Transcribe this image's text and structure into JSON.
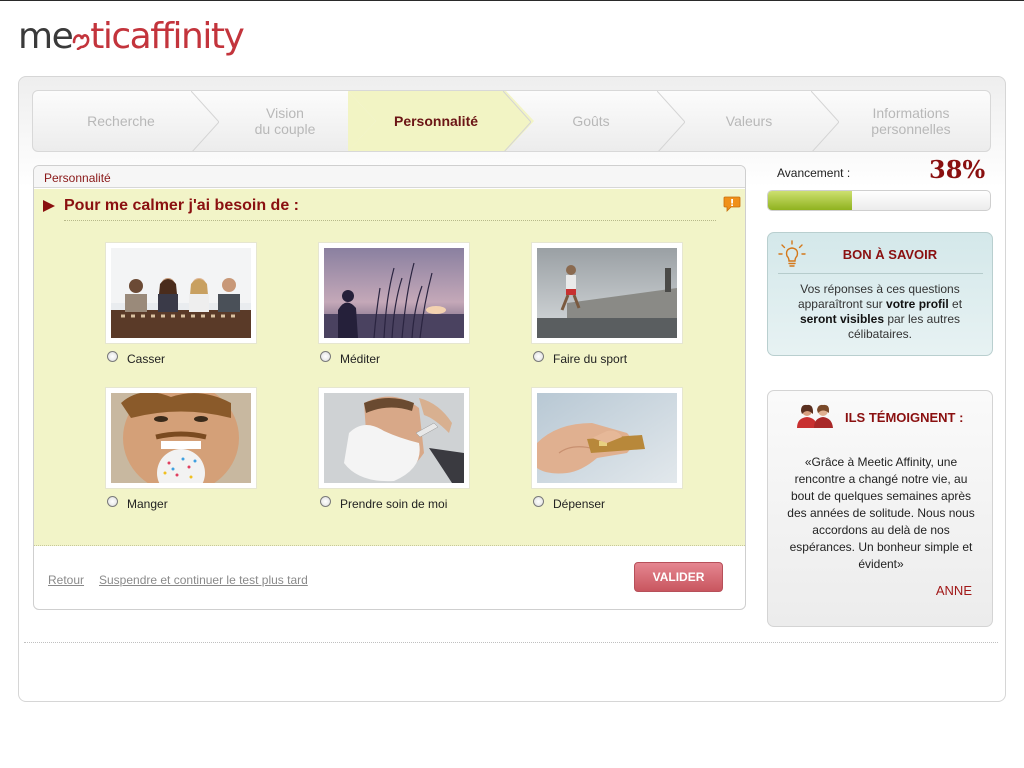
{
  "brand": {
    "logo_part1": "me",
    "logo_part2": "tic",
    "logo_part3": "affinity",
    "colors": {
      "brand_red": "#c3343c",
      "dark_red": "#8a1010",
      "question_bg": "#f2f4c8",
      "progress_green": "#9dbc2a"
    }
  },
  "steps": [
    {
      "label_line1": "Recherche",
      "label_line2": "",
      "state": "done"
    },
    {
      "label_line1": "Vision",
      "label_line2": "du couple",
      "state": "done"
    },
    {
      "label_line1": "Personnalité",
      "label_line2": "",
      "state": "active"
    },
    {
      "label_line1": "Goûts",
      "label_line2": "",
      "state": "upcoming"
    },
    {
      "label_line1": "Valeurs",
      "label_line2": "",
      "state": "upcoming"
    },
    {
      "label_line1": "Informations",
      "label_line2": "personnelles",
      "state": "upcoming"
    }
  ],
  "panel": {
    "header": "Personnalité",
    "question": "Pour me calmer j'ai besoin de :",
    "alert_icon": "alert-bubble-icon",
    "options": [
      {
        "label": "Casser",
        "image": "office-workers-photo",
        "selected": false
      },
      {
        "label": "Méditer",
        "image": "sunset-reeds-photo",
        "selected": false
      },
      {
        "label": "Faire du sport",
        "image": "jogger-photo",
        "selected": false
      },
      {
        "label": "Manger",
        "image": "man-eating-donut-photo",
        "selected": false
      },
      {
        "label": "Prendre soin de moi",
        "image": "man-shaving-photo",
        "selected": false
      },
      {
        "label": "Dépenser",
        "image": "credit-card-hand-photo",
        "selected": false
      }
    ],
    "footer": {
      "back_link": "Retour",
      "suspend_link": "Suspendre et continuer le test plus tard",
      "submit_button": "VALIDER"
    }
  },
  "progress": {
    "label": "Avancement :",
    "percent_text": "38%",
    "value": 0.38
  },
  "tip": {
    "icon": "lightbulb-icon",
    "title": "BON À SAVOIR",
    "text_1": "Vos réponses à ces questions apparaîtront sur ",
    "text_bold_1": "votre profil",
    "text_2": " et ",
    "text_bold_2": "seront visibles",
    "text_3": " par les autres célibataires."
  },
  "testimony": {
    "icon": "couple-icon",
    "title": "ILS TÉMOIGNENT :",
    "quote": "«Grâce à Meetic Affinity, une rencontre a changé notre vie, au bout de quelques semaines après des années de solitude. Nous nous accordons au delà de nos espérances. Un bonheur simple et évident»",
    "author": "ANNE"
  }
}
